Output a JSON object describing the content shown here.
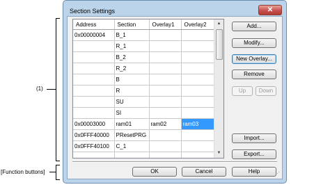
{
  "callouts": {
    "area_label": "(1)",
    "function_buttons_label": "[Function buttons]"
  },
  "window": {
    "title": "Section Settings",
    "close_glyph": "✕"
  },
  "table": {
    "columns": [
      "Address",
      "Section",
      "Overlay1",
      "Overlay2"
    ],
    "rows": [
      [
        "0x00000004",
        "B_1",
        "",
        ""
      ],
      [
        "",
        "R_1",
        "",
        ""
      ],
      [
        "",
        "B_2",
        "",
        ""
      ],
      [
        "",
        "R_2",
        "",
        ""
      ],
      [
        "",
        "B",
        "",
        ""
      ],
      [
        "",
        "R",
        "",
        ""
      ],
      [
        "",
        "SU",
        "",
        ""
      ],
      [
        "",
        "SI",
        "",
        ""
      ],
      [
        "0x00003000",
        "ram01",
        "ram02",
        "ram03"
      ],
      [
        "0x0FFF40000",
        "PResetPRG",
        "",
        ""
      ],
      [
        "0x0FFF40100",
        "C_1",
        "",
        ""
      ],
      [
        "",
        "",
        "",
        ""
      ]
    ],
    "selected_cell": {
      "row": 8,
      "col": 3
    }
  },
  "side_buttons": {
    "add": "Add...",
    "modify": "Modify...",
    "new_overlay": "New Overlay...",
    "remove": "Remove",
    "up": "Up",
    "down": "Down",
    "import": "Import...",
    "export": "Export..."
  },
  "function_buttons": {
    "ok": "OK",
    "cancel": "Cancel",
    "help": "Help"
  },
  "icons": {
    "scroll_up": "▲",
    "scroll_down": "▼",
    "resize_grip": "⋰"
  },
  "colors": {
    "selection": "#3399ff",
    "window_frame": "#bcd4ea",
    "close_button": "#c75050"
  }
}
